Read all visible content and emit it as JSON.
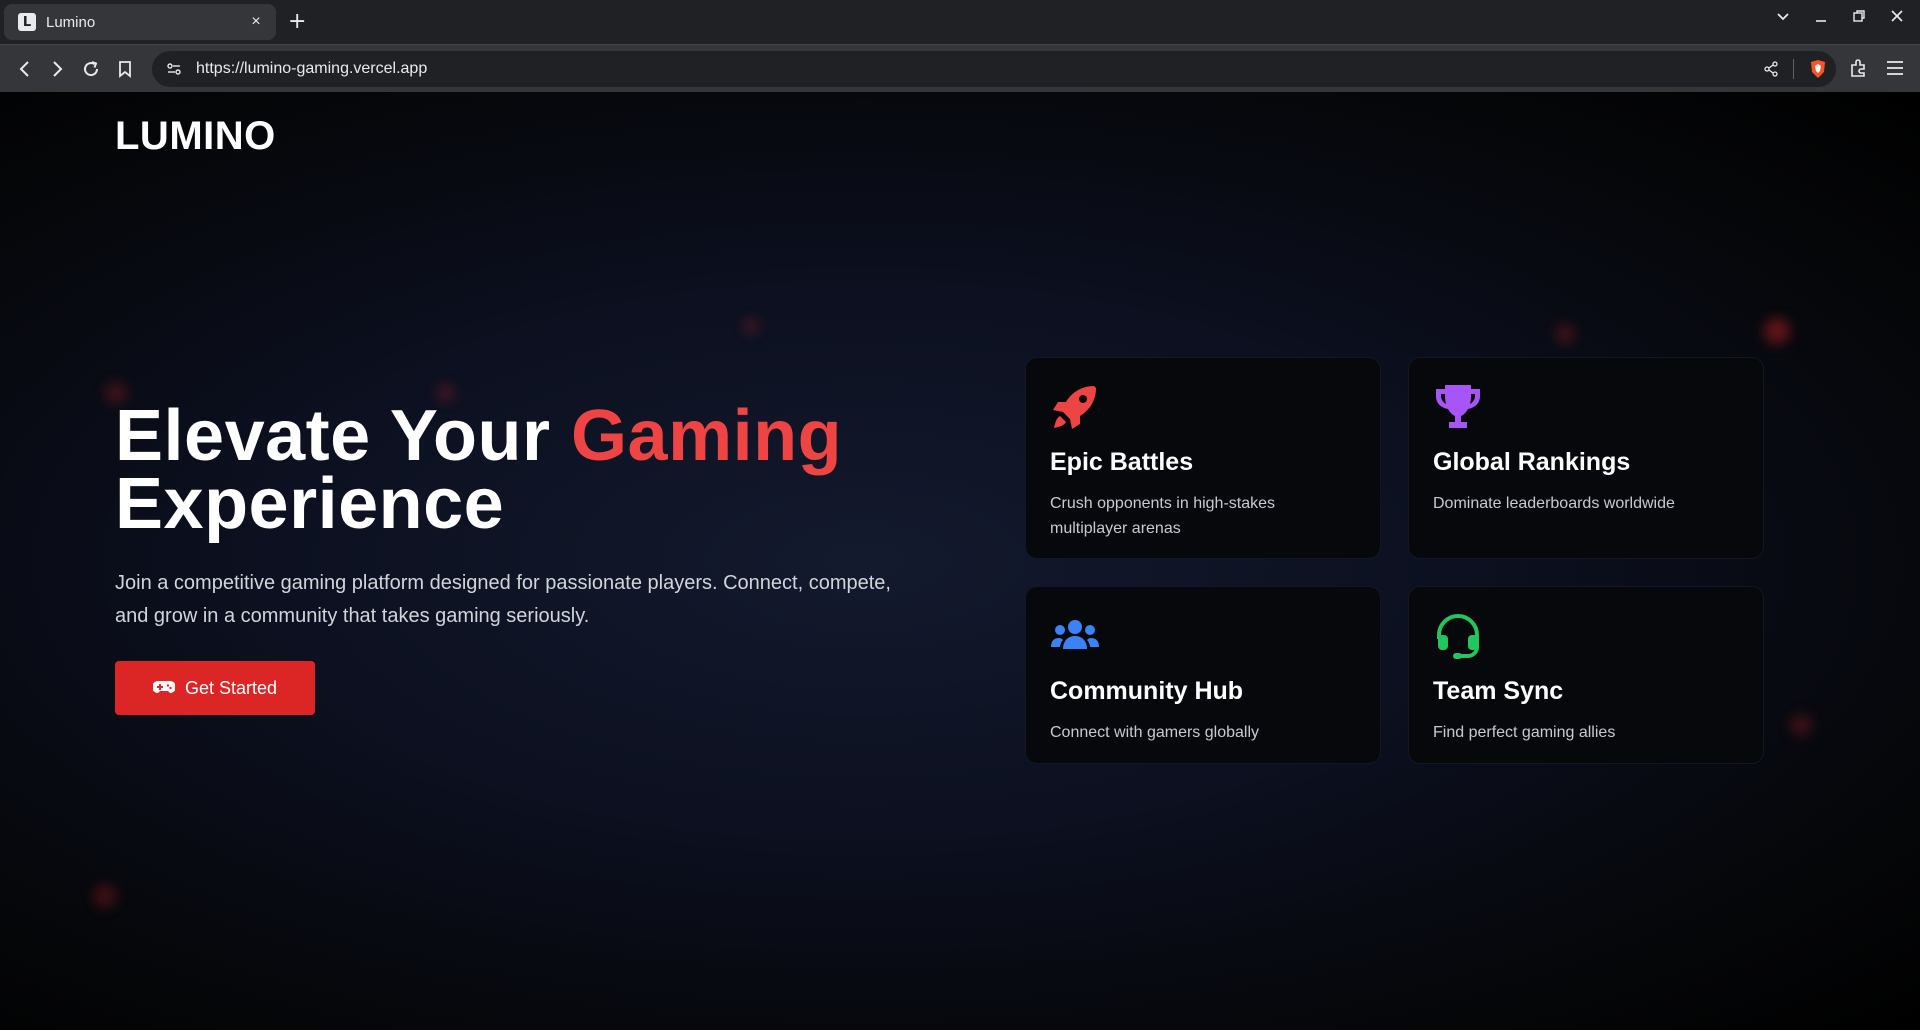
{
  "browser": {
    "tab_title": "Lumino",
    "tab_favicon_letter": "L",
    "tab_close": "×",
    "new_tab": "+",
    "url": "https://lumino-gaming.vercel.app"
  },
  "page": {
    "logo": "LUMINO",
    "hero": {
      "title_part1": "Elevate Your ",
      "title_accent": "Gaming",
      "title_part2": "Experience",
      "description": "Join a competitive gaming platform designed for passionate players. Connect, compete, and grow in a community that takes gaming seriously.",
      "cta_label": "Get Started",
      "cta_icon": "gamepad-icon"
    },
    "features": [
      {
        "icon": "rocket-icon",
        "color": "#ef4444",
        "title": "Epic Battles",
        "description": "Crush opponents in high-stakes multiplayer arenas"
      },
      {
        "icon": "trophy-icon",
        "color": "#a855f7",
        "title": "Global Rankings",
        "description": "Dominate leaderboards worldwide"
      },
      {
        "icon": "users-icon",
        "color": "#3b82f6",
        "title": "Community Hub",
        "description": "Connect with gamers globally"
      },
      {
        "icon": "headset-icon",
        "color": "#22c55e",
        "title": "Team Sync",
        "description": "Find perfect gaming allies"
      }
    ]
  },
  "colors": {
    "accent": "#ef4444",
    "button": "#dc2626",
    "chrome_dark": "#202124",
    "chrome_mid": "#35363a"
  }
}
